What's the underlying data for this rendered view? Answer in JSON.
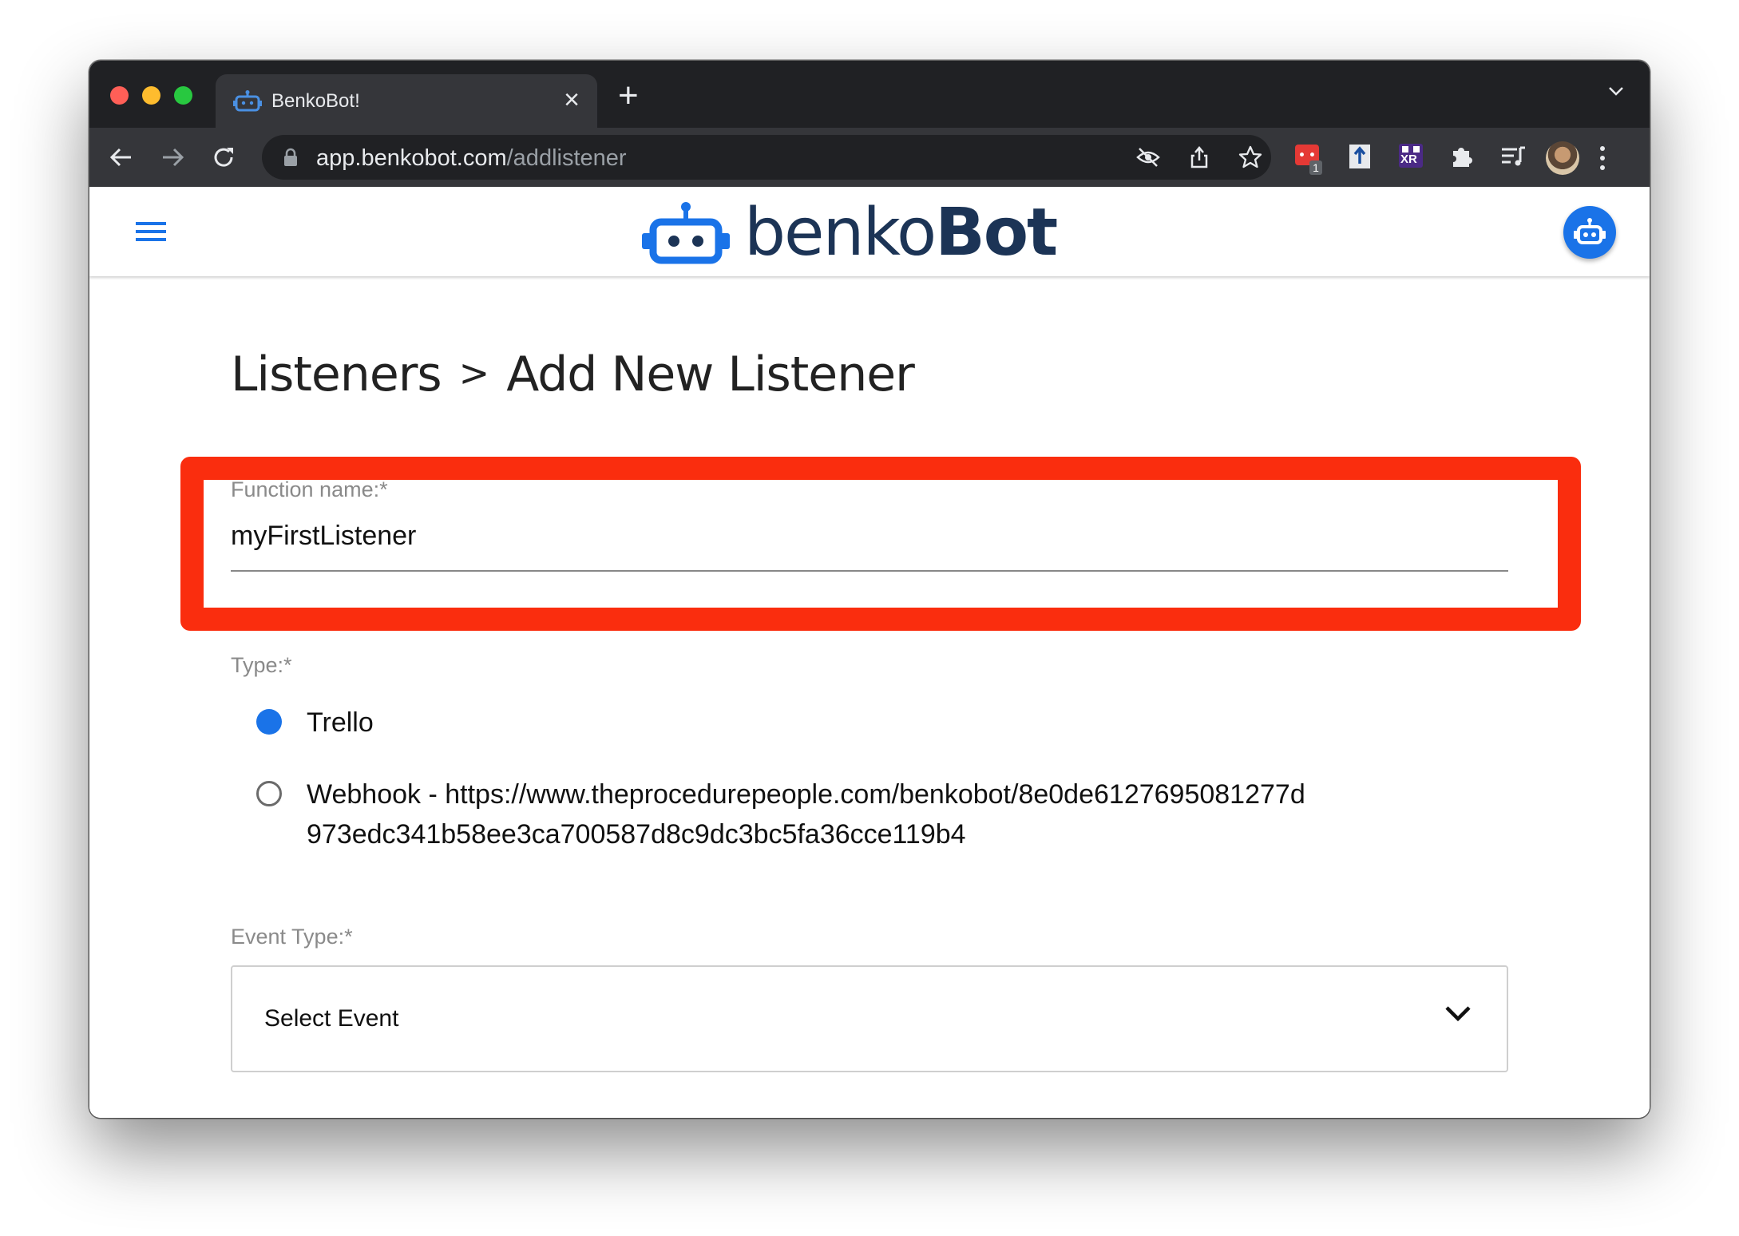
{
  "browser": {
    "tab_title": "BenkoBot!",
    "tab_close": "×",
    "new_tab": "+",
    "url_host": "app.benkobot.com",
    "url_path": "/addlistener",
    "extension_badge": "1",
    "xr_ext_label": "XR"
  },
  "app": {
    "logo_text_light": "benko",
    "logo_text_bold": "Bot",
    "accent_color": "#1a73e8",
    "brand_color": "#1c3456"
  },
  "breadcrumb": {
    "parent": "Listeners",
    "separator": ">",
    "current": "Add New Listener"
  },
  "form": {
    "function_name": {
      "label": "Function name:*",
      "value": "myFirstListener"
    },
    "type": {
      "label": "Type:*",
      "options": [
        {
          "label": "Trello",
          "selected": true
        },
        {
          "label": "Webhook - https://www.theprocedurepeople.com/benkobot/8e0de6127695081277d",
          "label_line2": "973edc341b58ee3ca700587d8c9dc3bc5fa36cce119b4",
          "selected": false
        }
      ]
    },
    "event_type": {
      "label": "Event Type:*",
      "selected": "Select Event"
    }
  },
  "annotation": {
    "highlight_color": "#fa2d0e"
  }
}
